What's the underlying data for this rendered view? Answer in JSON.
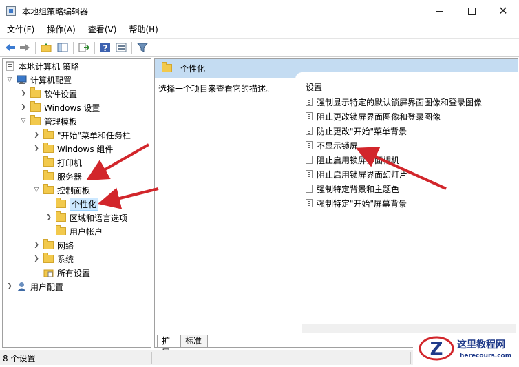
{
  "window": {
    "title": "本地组策略编辑器"
  },
  "menu": [
    {
      "label": "文件(F)"
    },
    {
      "label": "操作(A)"
    },
    {
      "label": "查看(V)"
    },
    {
      "label": "帮助(H)"
    }
  ],
  "toolbar_icons": [
    "back-arrow-icon",
    "forward-arrow-icon",
    "folder-up-icon",
    "show-hide-tree-icon",
    "export-icon",
    "help-icon",
    "properties-icon",
    "filter-icon"
  ],
  "tree": {
    "root": "本地计算机 策略",
    "computer_config": "计算机配置",
    "software_settings": "软件设置",
    "windows_settings": "Windows 设置",
    "admin_templates": "管理模板",
    "start_menu": "\"开始\"菜单和任务栏",
    "windows_components": "Windows 组件",
    "printers": "打印机",
    "server": "服务器",
    "control_panel": "控制面板",
    "personalization": "个性化",
    "regional": "区域和语言选项",
    "user_accounts": "用户帐户",
    "network": "网络",
    "system": "系统",
    "all_settings": "所有设置",
    "user_config": "用户配置"
  },
  "right": {
    "header": "个性化",
    "description": "选择一个项目来查看它的描述。",
    "column": "设置",
    "settings": [
      "强制显示特定的默认锁屏界面图像和登录图像",
      "阻止更改锁屏界面图像和登录图像",
      "防止更改\"开始\"菜单背景",
      "不显示锁屏",
      "阻止启用锁屏界面相机",
      "阻止启用锁屏界面幻灯片",
      "强制特定背景和主题色",
      "强制特定\"开始\"屏幕背景"
    ]
  },
  "tabs": {
    "extended": "扩展",
    "standard": "标准"
  },
  "status": {
    "count": "8 个设置"
  },
  "watermark": {
    "name": "这里教程网",
    "url": "herecours.com"
  },
  "colors": {
    "header_band": "#c4dcf2",
    "selection": "#cce8ff",
    "arrow": "#d2262b",
    "folder": "#f2c94c"
  }
}
